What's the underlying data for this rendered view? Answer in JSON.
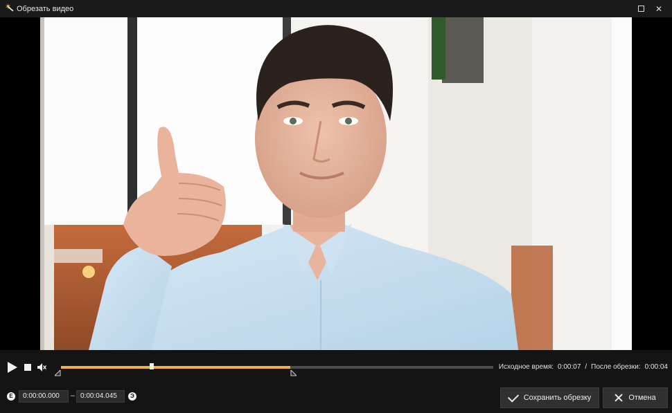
{
  "window": {
    "title": "Обрезать видео",
    "controls": [
      "maximize",
      "close"
    ]
  },
  "player": {
    "duration_label": "Исходное время:",
    "duration_value": "0:00:07",
    "separator": "/",
    "after_label": "После обрезки:",
    "after_value": "0:00:04",
    "playhead_fraction": 0.21,
    "selection_start_fraction": 0.0,
    "selection_end_fraction": 0.53
  },
  "trim": {
    "start_icon": "Е",
    "start_value": "0:00:00.000",
    "dash": "–",
    "end_value": "0:00:04.045",
    "end_icon": "Э"
  },
  "buttons": {
    "save_label": "Сохранить обрезку",
    "cancel_label": "Отмена"
  },
  "colors": {
    "accent": "#f0b34a",
    "background": "#141414"
  },
  "video_icons": [
    "play-icon",
    "stop-icon",
    "mute-icon"
  ]
}
